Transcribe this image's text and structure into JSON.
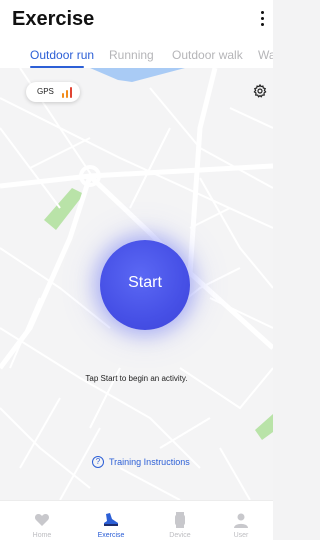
{
  "header": {
    "title": "Exercise",
    "more_icon": "more-vertical-icon"
  },
  "tabs": [
    {
      "label": "Outdoor run",
      "active": true
    },
    {
      "label": "Running",
      "active": false
    },
    {
      "label": "Outdoor walk",
      "active": false
    },
    {
      "label": "Wa",
      "active": false
    }
  ],
  "gps": {
    "label": "GPS",
    "signal_icon": "signal-bars-icon",
    "signal_color": "#f28c1b"
  },
  "settings_icon": "gear-icon",
  "start": {
    "label": "Start",
    "color": "#4650e6"
  },
  "hint": "Tap Start to begin an activity.",
  "training": {
    "icon": "question-circle-icon",
    "label": "Training Instructions"
  },
  "bottom_nav": [
    {
      "label": "Home",
      "icon": "heart-icon",
      "active": false
    },
    {
      "label": "Exercise",
      "icon": "running-shoe-icon",
      "active": true
    },
    {
      "label": "Device",
      "icon": "watch-icon",
      "active": false
    },
    {
      "label": "User",
      "icon": "person-icon",
      "active": false
    }
  ],
  "colors": {
    "accent": "#2c5fd6",
    "map_water": "#a9cbf5",
    "map_park": "#b9e3a8",
    "inactive": "#bdbdc1"
  }
}
